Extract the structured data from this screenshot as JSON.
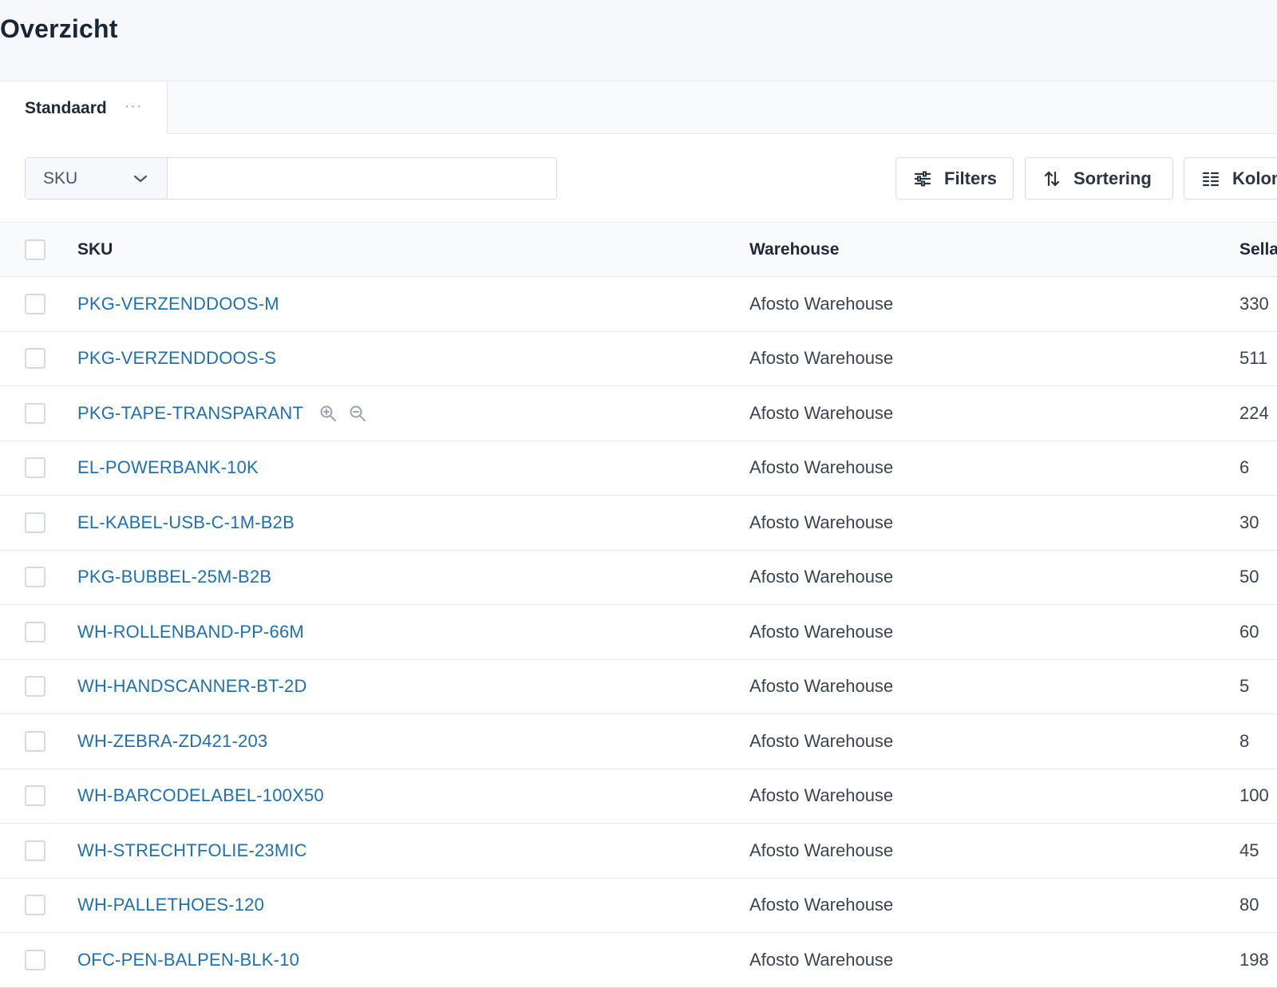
{
  "page": {
    "title": "Overzicht"
  },
  "tabs": [
    {
      "label": "Standaard",
      "more": "···"
    }
  ],
  "search": {
    "field": "SKU",
    "value": "",
    "placeholder": ""
  },
  "toolbar": {
    "filters_label": "Filters",
    "sort_label": "Sortering",
    "columns_label": "Kolommen"
  },
  "table": {
    "headers": {
      "sku": "SKU",
      "warehouse": "Warehouse",
      "sellable": "Sellable"
    },
    "rows": [
      {
        "sku": "PKG-VERZENDDOOS-M",
        "warehouse": "Afosto Warehouse",
        "sellable": "330"
      },
      {
        "sku": "PKG-VERZENDDOOS-S",
        "warehouse": "Afosto Warehouse",
        "sellable": "511"
      },
      {
        "sku": "PKG-TAPE-TRANSPARANT",
        "warehouse": "Afosto Warehouse",
        "sellable": "224",
        "zoom_icons": [
          "zoom-in-icon",
          "zoom-out-icon"
        ]
      },
      {
        "sku": "EL-POWERBANK-10K",
        "warehouse": "Afosto Warehouse",
        "sellable": "6"
      },
      {
        "sku": "EL-KABEL-USB-C-1M-B2B",
        "warehouse": "Afosto Warehouse",
        "sellable": "30"
      },
      {
        "sku": "PKG-BUBBEL-25M-B2B",
        "warehouse": "Afosto Warehouse",
        "sellable": "50"
      },
      {
        "sku": "WH-ROLLENBAND-PP-66M",
        "warehouse": "Afosto Warehouse",
        "sellable": "60"
      },
      {
        "sku": "WH-HANDSCANNER-BT-2D",
        "warehouse": "Afosto Warehouse",
        "sellable": "5"
      },
      {
        "sku": "WH-ZEBRA-ZD421-203",
        "warehouse": "Afosto Warehouse",
        "sellable": "8"
      },
      {
        "sku": "WH-BARCODELABEL-100X50",
        "warehouse": "Afosto Warehouse",
        "sellable": "100"
      },
      {
        "sku": "WH-STRECHTFOLIE-23MIC",
        "warehouse": "Afosto Warehouse",
        "sellable": "45"
      },
      {
        "sku": "WH-PALLETHOES-120",
        "warehouse": "Afosto Warehouse",
        "sellable": "80"
      },
      {
        "sku": "OFC-PEN-BALPEN-BLK-10",
        "warehouse": "Afosto Warehouse",
        "sellable": "198"
      }
    ]
  },
  "colors": {
    "link": "#1f6fb2",
    "header_bg": "#f6f8fb",
    "border": "#e3e7ed"
  }
}
